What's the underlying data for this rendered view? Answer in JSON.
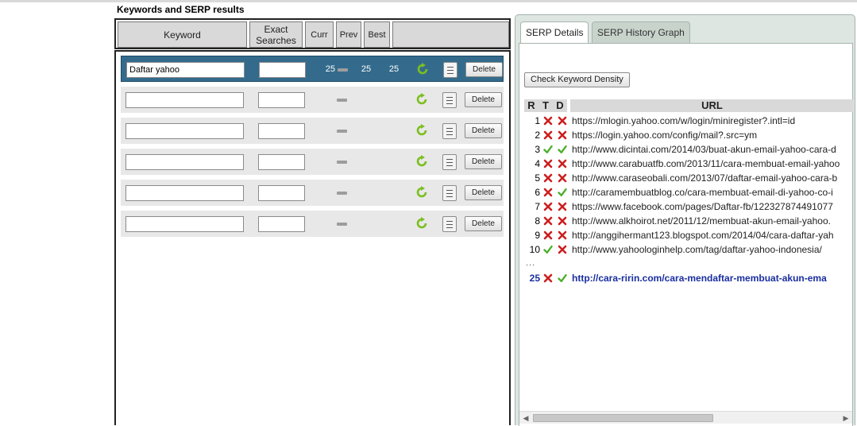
{
  "section_title": "Keywords and SERP results",
  "table_headers": {
    "keyword": "Keyword",
    "exact_line1": "Exact",
    "exact_line2": "Searches",
    "curr": "Curr",
    "prev": "Prev",
    "best": "Best"
  },
  "rows": [
    {
      "keyword": "Daftar yahoo",
      "exact": "",
      "curr": "25",
      "prev": "25",
      "best": "25",
      "delete": "Delete",
      "selected": true
    },
    {
      "keyword": "",
      "exact": "",
      "curr": "",
      "prev": "",
      "best": "",
      "delete": "Delete",
      "selected": false
    },
    {
      "keyword": "",
      "exact": "",
      "curr": "",
      "prev": "",
      "best": "",
      "delete": "Delete",
      "selected": false
    },
    {
      "keyword": "",
      "exact": "",
      "curr": "",
      "prev": "",
      "best": "",
      "delete": "Delete",
      "selected": false
    },
    {
      "keyword": "",
      "exact": "",
      "curr": "",
      "prev": "",
      "best": "",
      "delete": "Delete",
      "selected": false
    },
    {
      "keyword": "",
      "exact": "",
      "curr": "",
      "prev": "",
      "best": "",
      "delete": "Delete",
      "selected": false
    }
  ],
  "tabs": [
    {
      "label": "SERP Details",
      "active": true
    },
    {
      "label": "SERP History Graph",
      "active": false
    }
  ],
  "check_density_label": "Check Keyword Density",
  "serp_headers": {
    "r": "R",
    "t": "T",
    "d": "D",
    "url": "URL"
  },
  "serp_results": [
    {
      "rank": "1",
      "t": "cross",
      "d": "cross",
      "url": "https://mlogin.yahoo.com/w/login/miniregister?.intl=id"
    },
    {
      "rank": "2",
      "t": "cross",
      "d": "cross",
      "url": "https://login.yahoo.com/config/mail?.src=ym"
    },
    {
      "rank": "3",
      "t": "check",
      "d": "check",
      "url": "http://www.dicintai.com/2014/03/buat-akun-email-yahoo-cara-d"
    },
    {
      "rank": "4",
      "t": "cross",
      "d": "cross",
      "url": "http://www.carabuatfb.com/2013/11/cara-membuat-email-yahoo"
    },
    {
      "rank": "5",
      "t": "cross",
      "d": "cross",
      "url": "http://www.caraseobali.com/2013/07/daftar-email-yahoo-cara-b"
    },
    {
      "rank": "6",
      "t": "cross",
      "d": "check",
      "url": "http://caramembuatblog.co/cara-membuat-email-di-yahoo-co-i"
    },
    {
      "rank": "7",
      "t": "cross",
      "d": "cross",
      "url": "https://www.facebook.com/pages/Daftar-fb/122327874491077"
    },
    {
      "rank": "8",
      "t": "cross",
      "d": "cross",
      "url": "http://www.alkhoirot.net/2011/12/membuat-akun-email-yahoo."
    },
    {
      "rank": "9",
      "t": "cross",
      "d": "cross",
      "url": "http://anggihermant123.blogspot.com/2014/04/cara-daftar-yah"
    },
    {
      "rank": "10",
      "t": "check",
      "d": "cross",
      "url": "http://www.yahoologinhelp.com/tag/daftar-yahoo-indonesia/"
    }
  ],
  "ellipsis": "...",
  "own_result": {
    "rank": "25",
    "t": "cross",
    "d": "check",
    "url": "http://cara-ririn.com/cara-mendaftar-membuat-akun-ema"
  },
  "colors": {
    "selected_row": "#346b8c",
    "cross": "#cc1f1f",
    "check": "#4caf2a",
    "own_link": "#1a2ea0"
  },
  "icons": {
    "refresh": "refresh-icon",
    "details": "list-icon",
    "cross": "cross-icon",
    "check": "check-icon"
  }
}
